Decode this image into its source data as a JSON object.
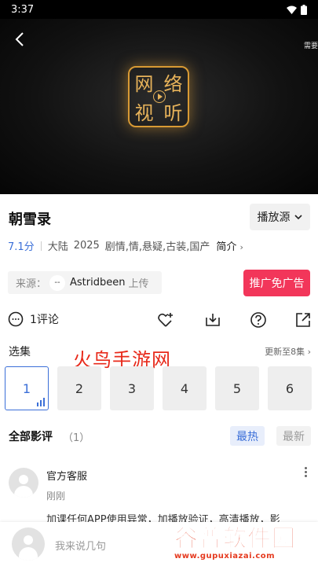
{
  "status_bar": {
    "time": "3:37"
  },
  "player": {
    "hint": "需要",
    "logo_chars": [
      "网",
      "络",
      "视",
      "听"
    ]
  },
  "video": {
    "title": "朝雪录",
    "source_label": "播放源",
    "score": "7.1分",
    "region": "大陆",
    "year": "2025",
    "genres": "剧情,情,悬疑,古装,国产",
    "intro_label": "简介"
  },
  "uploader": {
    "prefix": "来源：",
    "avatar_char": "--",
    "name": "Astridbeen",
    "suffix": "上传"
  },
  "ad_button": {
    "label": "推广免广告"
  },
  "actions": {
    "comment_count_label": "1评论",
    "icons": [
      "comment-icon",
      "favorite-plus-icon",
      "download-icon",
      "help-icon",
      "share-icon"
    ]
  },
  "episodes": {
    "title": "选集",
    "update_info": "更新至8集",
    "items": [
      "1",
      "2",
      "3",
      "4",
      "5",
      "6"
    ],
    "active_index": 0
  },
  "watermark_text": "火鸟手游网",
  "reviews": {
    "title": "全部影评",
    "count": "（1）",
    "tab_hot": "最热",
    "tab_new": "最新",
    "items": [
      {
        "author": "官方客服",
        "time": "刚刚",
        "text": "加课任何APP使用异常，加播放验证，高清播放，影"
      }
    ]
  },
  "input_bar": {
    "placeholder": "我来说几句"
  },
  "site_watermark": {
    "main": "谷普软件园",
    "url": "www.gupuxiazai.com"
  },
  "colors": {
    "accent": "#3b6fd8",
    "ad_button": "#f2365a",
    "watermark_red": "#e8291a",
    "logo_gold": "#d89a34"
  }
}
